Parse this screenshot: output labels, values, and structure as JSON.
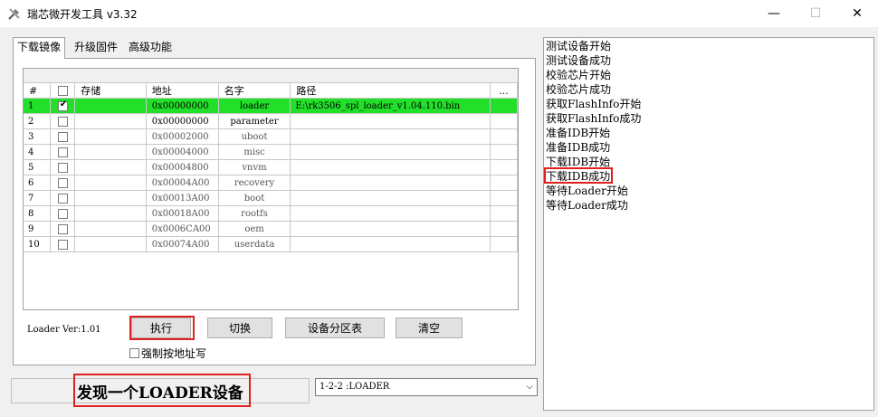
{
  "window": {
    "title": "瑞芯微开发工具 v3.32",
    "controls": {
      "minimize": "—",
      "maximize": "☐",
      "close": "✕"
    }
  },
  "tabs": [
    {
      "label": "下载镜像",
      "active": true
    },
    {
      "label": "升级固件",
      "active": false
    },
    {
      "label": "高级功能",
      "active": false
    }
  ],
  "table": {
    "headers": {
      "num": "#",
      "check": "",
      "storage": "存储",
      "address": "地址",
      "name": "名字",
      "path": "路径",
      "more": "..."
    },
    "rows": [
      {
        "num": "1",
        "checked": true,
        "storage": "",
        "address": "0x00000000",
        "name": "loader",
        "path": "E:\\rk3506_spl_loader_v1.04.110.bin"
      },
      {
        "num": "2",
        "checked": false,
        "storage": "",
        "address": "0x00000000",
        "name": "parameter",
        "path": ""
      },
      {
        "num": "3",
        "checked": false,
        "storage": "",
        "address": "0x00002000",
        "name": "uboot",
        "path": ""
      },
      {
        "num": "4",
        "checked": false,
        "storage": "",
        "address": "0x00004000",
        "name": "misc",
        "path": ""
      },
      {
        "num": "5",
        "checked": false,
        "storage": "",
        "address": "0x00004800",
        "name": "vnvm",
        "path": ""
      },
      {
        "num": "6",
        "checked": false,
        "storage": "",
        "address": "0x00004A00",
        "name": "recovery",
        "path": ""
      },
      {
        "num": "7",
        "checked": false,
        "storage": "",
        "address": "0x00013A00",
        "name": "boot",
        "path": ""
      },
      {
        "num": "8",
        "checked": false,
        "storage": "",
        "address": "0x00018A00",
        "name": "rootfs",
        "path": ""
      },
      {
        "num": "9",
        "checked": false,
        "storage": "",
        "address": "0x0006CA00",
        "name": "oem",
        "path": ""
      },
      {
        "num": "10",
        "checked": false,
        "storage": "",
        "address": "0x00074A00",
        "name": "userdata",
        "path": ""
      }
    ]
  },
  "loader_version": "Loader Ver:1.01",
  "buttons": {
    "execute": "执行",
    "switch": "切换",
    "partition_table": "设备分区表",
    "clear": "清空"
  },
  "force_address_label": "强制按地址写",
  "status_text": "发现一个LOADER设备",
  "device_combo": {
    "selected": "1-2-2 :LOADER"
  },
  "log": [
    "测试设备开始",
    "测试设备成功",
    "校验芯片开始",
    "校验芯片成功",
    "获取FlashInfo开始",
    "获取FlashInfo成功",
    "准备IDB开始",
    "准备IDB成功",
    "下载IDB开始",
    "下载IDB成功",
    "等待Loader开始",
    "等待Loader成功"
  ],
  "colors": {
    "selected_row": "#22e02a",
    "highlight_box": "#e02020"
  }
}
